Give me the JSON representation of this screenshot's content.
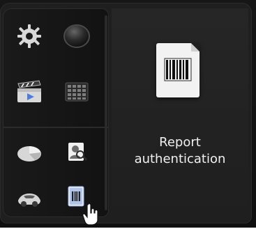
{
  "launcher": {
    "items": [
      {
        "icon": "gear-icon"
      },
      {
        "icon": "round-button-icon"
      },
      {
        "icon": "clapperboard-icon"
      },
      {
        "icon": "calendar-grid-icon"
      },
      {
        "icon": "pie-chart-icon"
      },
      {
        "icon": "person-search-icon"
      },
      {
        "icon": "sports-car-icon"
      },
      {
        "icon": "barcode-icon"
      }
    ],
    "cursor": "hand-pointer-icon"
  },
  "detail": {
    "icon": "barcode-document-icon",
    "title_line1": "Report",
    "title_line2": "authentication"
  }
}
